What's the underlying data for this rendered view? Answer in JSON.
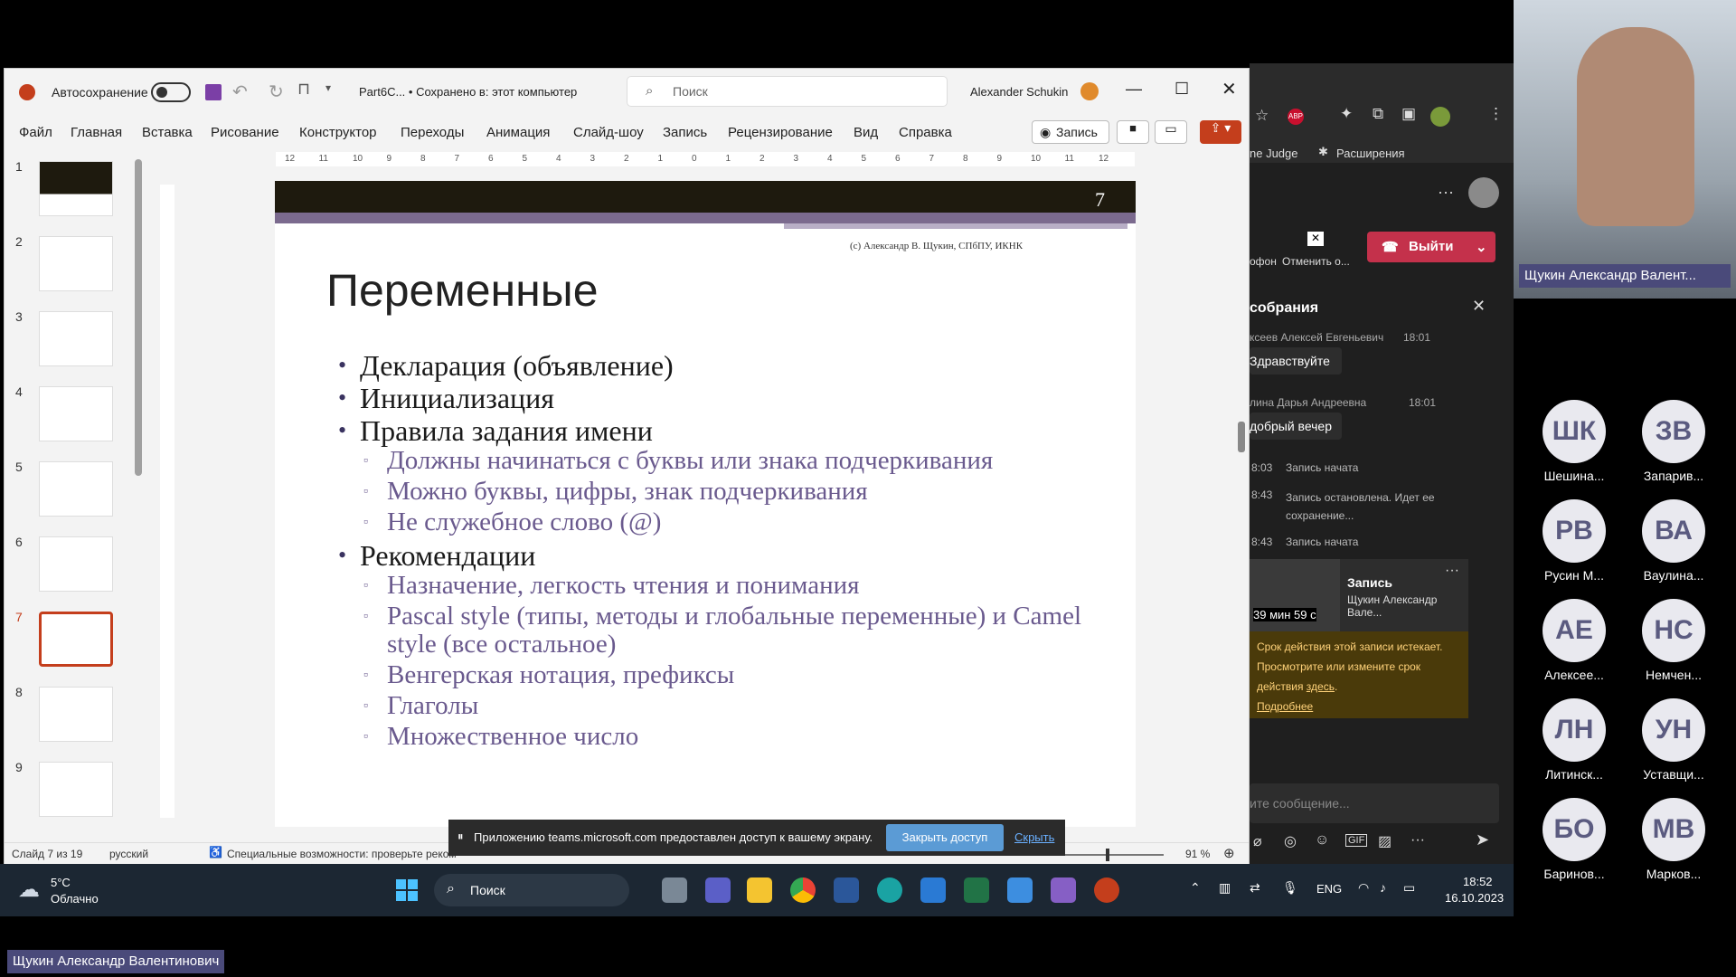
{
  "ppt": {
    "autosave_label": "Автосохранение",
    "doc_title": "Part6C... • Сохранено в: этот компьютер",
    "search_placeholder": "Поиск",
    "user_name": "Alexander Schukin",
    "menu": [
      "Файл",
      "Главная",
      "Вставка",
      "Рисование",
      "Конструктор",
      "Переходы",
      "Анимация",
      "Слайд-шоу",
      "Запись",
      "Рецензирование",
      "Вид",
      "Справка"
    ],
    "record_button": "Запись",
    "thumb_numbers": [
      "1",
      "2",
      "3",
      "4",
      "5",
      "6",
      "7",
      "8",
      "9"
    ],
    "ruler_numbers": [
      "12",
      "11",
      "10",
      "9",
      "8",
      "7",
      "6",
      "5",
      "4",
      "3",
      "2",
      "1",
      "0",
      "1",
      "2",
      "3",
      "4",
      "5",
      "6",
      "7",
      "8",
      "9",
      "10",
      "11",
      "12"
    ],
    "status": {
      "slide_info": "Слайд 7 из 19",
      "language": "русский",
      "accessibility": "Специальные возможности: проверьте реком",
      "zoom": "91 %"
    }
  },
  "slide": {
    "number": "7",
    "copyright": "(с) Александр В. Щукин, СПбПУ, ИКНК",
    "title": "Переменные",
    "items": [
      {
        "level": 1,
        "text": "Декларация (объявление)"
      },
      {
        "level": 1,
        "text": "Инициализация"
      },
      {
        "level": 1,
        "text": "Правила задания имени"
      },
      {
        "level": 2,
        "text": "Должны начинаться с буквы или знака подчеркивания"
      },
      {
        "level": 2,
        "text": "Можно буквы, цифры, знак подчеркивания"
      },
      {
        "level": 2,
        "text": "Не служебное слово (@)"
      },
      {
        "level": 1,
        "text": "Рекомендации"
      },
      {
        "level": 2,
        "text": "Назначение, легкость чтения и понимания"
      },
      {
        "level": 2,
        "text": "Pascal style (типы, методы и глобальные переменные)  и Camel style (все остальное)"
      },
      {
        "level": 2,
        "text": "Венгерская нотация, префиксы"
      },
      {
        "level": 2,
        "text": "Глаголы"
      },
      {
        "level": 2,
        "text": "Множественное число"
      }
    ]
  },
  "share_banner": {
    "text": "Приложению teams.microsoft.com предоставлен доступ к вашему экрану.",
    "stop_button": "Закрыть доступ",
    "hide_link": "Скрыть"
  },
  "browser": {
    "bookmark1": "ne Judge",
    "bookmark2": "Расширения"
  },
  "teams": {
    "leave_button": "Выйти",
    "cancel_label": "Отменить о...",
    "mic_label": "офон",
    "chat_title": "собрания",
    "messages": [
      {
        "sender": "ксеев Алексей Евгеньевич",
        "time": "18:01",
        "text": "Здравствуйте"
      },
      {
        "sender": "лина Дарья Андреевна",
        "time": "18:01",
        "text": "добрый вечер"
      }
    ],
    "events": [
      {
        "time": "8:03",
        "text": "Запись начата"
      },
      {
        "time": "8:43",
        "text": "Запись остановлена. Идет ее сохранение..."
      },
      {
        "time": "8:43",
        "text": "Запись начата"
      }
    ],
    "recording_card": {
      "title": "Запись",
      "owner": "Щукин Александр Вале...",
      "duration": "39 мин 59 с"
    },
    "notice": {
      "text": "Срок действия этой записи истекает. Просмотрите или измените срок действия",
      "link_here": "здесь",
      "link_more": "Подробнее"
    },
    "compose_placeholder": "ите сообщение..."
  },
  "video": {
    "name_label": "Щукин Александр Валент..."
  },
  "participants": [
    {
      "initials": "ШК",
      "name": "Шешина..."
    },
    {
      "initials": "ЗВ",
      "name": "Запарив..."
    },
    {
      "initials": "РВ",
      "name": "Русин М..."
    },
    {
      "initials": "ВА",
      "name": "Ваулина..."
    },
    {
      "initials": "АЕ",
      "name": "Алексее..."
    },
    {
      "initials": "НС",
      "name": "Немчен..."
    },
    {
      "initials": "ЛН",
      "name": "Литинск..."
    },
    {
      "initials": "УН",
      "name": "Уставщи..."
    },
    {
      "initials": "БО",
      "name": "Баринов..."
    },
    {
      "initials": "МВ",
      "name": "Марков..."
    }
  ],
  "taskbar": {
    "weather_temp": "5°C",
    "weather_desc": "Облачно",
    "search_label": "Поиск",
    "lang": "ENG",
    "time": "18:52",
    "date": "16.10.2023"
  },
  "bottom_label": "Щукин Александр Валентинович",
  "colors": {
    "accent_red": "#c43e1c",
    "teams_leave": "#c4314b",
    "slide_header": "#1e1a0e",
    "slide_purple": "#7b6a8e",
    "bullet_sub": "#6a5a8e"
  }
}
